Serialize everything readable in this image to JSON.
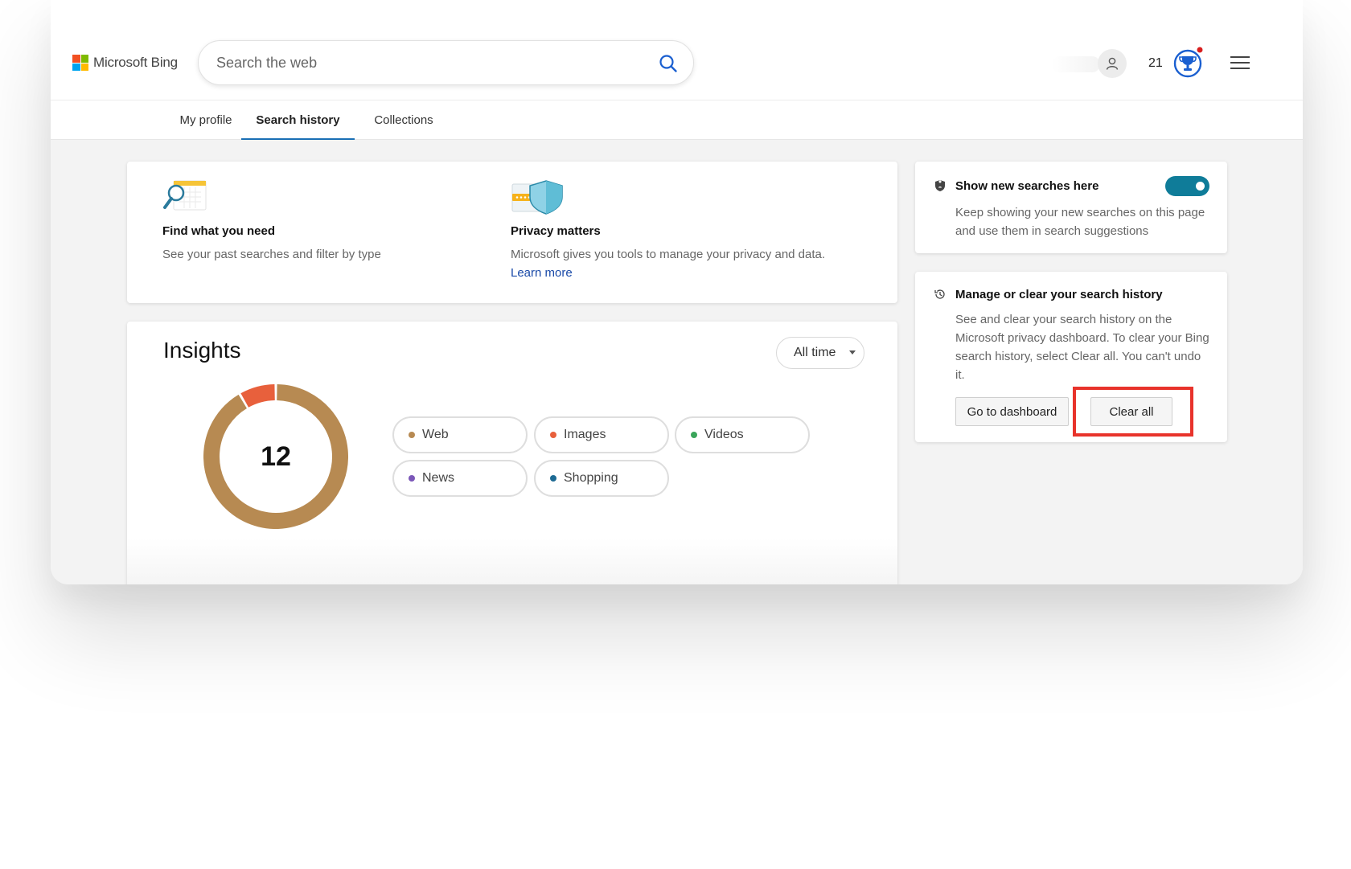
{
  "header": {
    "logo_text": "Microsoft Bing",
    "search_placeholder": "Search the web",
    "points": "21"
  },
  "tabs": [
    {
      "label": "My profile",
      "active": false
    },
    {
      "label": "Search history",
      "active": true
    },
    {
      "label": "Collections",
      "active": false
    }
  ],
  "intro": {
    "find": {
      "title": "Find what you need",
      "desc": "See your past searches and filter by type"
    },
    "privacy": {
      "title": "Privacy matters",
      "desc": "Microsoft gives you tools to manage your privacy and data.",
      "link": "Learn more"
    }
  },
  "insights": {
    "title": "Insights",
    "range": "All time",
    "filters": [
      {
        "label": "Web",
        "color": "#b78a52"
      },
      {
        "label": "Images",
        "color": "#e8603c"
      },
      {
        "label": "Videos",
        "color": "#3aa55a"
      },
      {
        "label": "News",
        "color": "#7b57b8"
      },
      {
        "label": "Shopping",
        "color": "#1d6a93"
      }
    ]
  },
  "chart_data": {
    "type": "pie",
    "donut": true,
    "center_label": "12",
    "series": [
      {
        "name": "Web",
        "color": "#b78a52",
        "value": 11
      },
      {
        "name": "Images",
        "color": "#e8603c",
        "value": 1
      }
    ]
  },
  "side": {
    "show_new": {
      "title": "Show new searches here",
      "desc": "Keep showing your new searches on this page and use them in search suggestions",
      "toggle_on": true
    },
    "manage": {
      "title": "Manage or clear your search history",
      "desc": "See and clear your search history on the Microsoft privacy dashboard. To clear your Bing search history, select Clear all. You can't undo it.",
      "dashboard_button": "Go to dashboard",
      "clear_button": "Clear all"
    }
  },
  "colors": {
    "accent": "#1a6fb5",
    "toggle": "#0f7c99",
    "highlight": "#e8332b"
  }
}
